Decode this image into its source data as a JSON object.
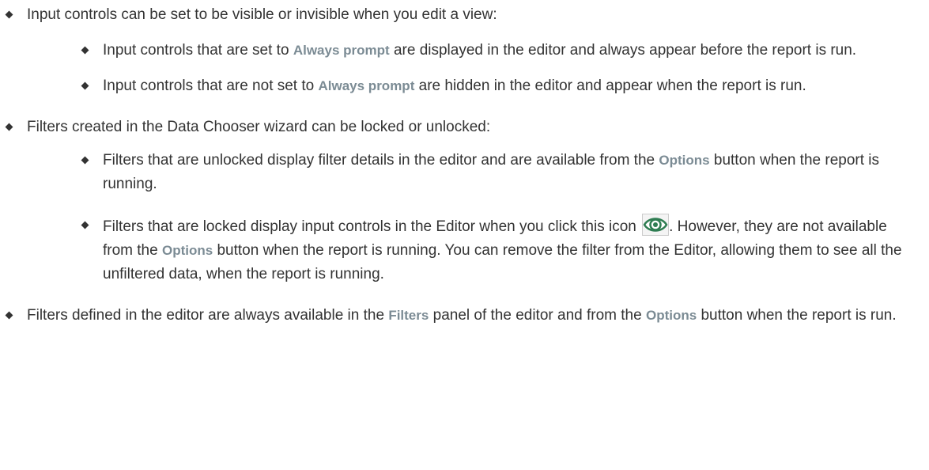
{
  "items": [
    {
      "text": "Input controls can be set to be visible or invisible when you edit a view:",
      "sub": [
        {
          "pre": "Input controls that are set to ",
          "ui": "Always prompt",
          "post": " are displayed in the editor and always appear before the report is run."
        },
        {
          "pre": "Input controls that are not set to ",
          "ui": "Always prompt",
          "post": " are hidden in the editor and appear when the report is run."
        }
      ]
    },
    {
      "text": "Filters created in the Data Chooser wizard can be locked or unlocked:",
      "sub": [
        {
          "pre": "Filters that are unlocked display filter details in the editor and are available from the ",
          "ui": "Options",
          "post": " button when the report is running."
        },
        {
          "pre": "Filters that are locked display input controls in the Editor when you click this icon",
          "icon": "eye-icon",
          "mid": ". However, they are not available from the ",
          "ui": "Options",
          "post": " button when the report is running. You can remove the filter from the Editor, allowing them to see all the unfiltered data, when the report is running."
        }
      ]
    },
    {
      "pre": "Filters defined in the editor are always available in the ",
      "ui1": "Filters",
      "mid": " panel of the editor and from the ",
      "ui2": "Options",
      "post": " button when the report is run."
    }
  ],
  "colors": {
    "text": "#333333",
    "ui_term": "#7b8b94",
    "icon_ring": "#3a8a5c"
  }
}
